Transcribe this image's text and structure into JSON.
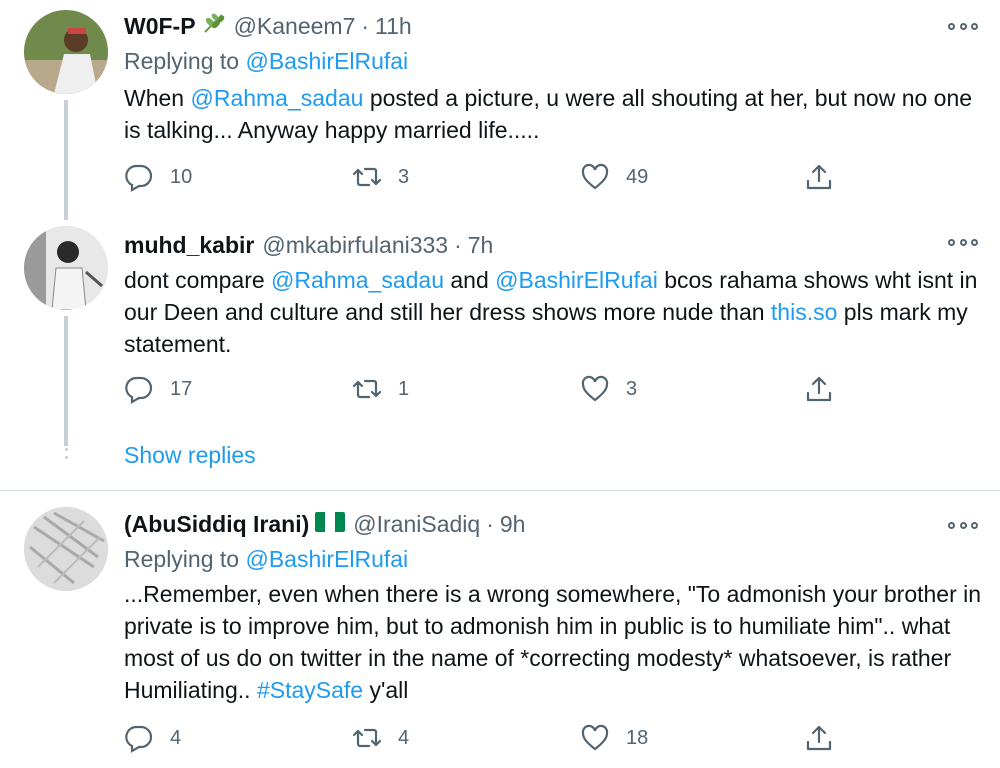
{
  "tweets": [
    {
      "name": "W0F-P",
      "emoji": "herb",
      "handle": "@Kaneem7",
      "time": "11h",
      "replying_prefix": "Replying to",
      "replying_to": "@BashirElRufai",
      "body_parts": [
        {
          "text": "When ",
          "link": false
        },
        {
          "text": "@Rahma_sadau",
          "link": true
        },
        {
          "text": " posted a picture, u were all shouting at her, but now no one is talking... Anyway happy married life.....",
          "link": false
        }
      ],
      "replies": "10",
      "retweets": "3",
      "likes": "49"
    },
    {
      "name": "muhd_kabir",
      "handle": "@mkabirfulani333",
      "time": "7h",
      "body_parts": [
        {
          "text": "dont compare ",
          "link": false
        },
        {
          "text": "@Rahma_sadau",
          "link": true
        },
        {
          "text": " and ",
          "link": false
        },
        {
          "text": "@BashirElRufai",
          "link": true
        },
        {
          "text": " bcos rahama shows wht isnt in our Deen and culture and still her dress shows more nude than ",
          "link": false
        },
        {
          "text": "this.so",
          "link": true
        },
        {
          "text": " pls mark my statement.",
          "link": false
        }
      ],
      "replies": "17",
      "retweets": "1",
      "likes": "3"
    },
    {
      "name": "(AbuSiddiq Irani)",
      "flag": "nigeria-flag",
      "handle": "@IraniSadiq",
      "time": "9h",
      "replying_prefix": "Replying to",
      "replying_to": "@BashirElRufai",
      "body_parts": [
        {
          "text": "...Remember, even when there is a wrong somewhere, \"To admonish your brother in private is to improve him, but to admonish him in public is to humiliate him\".. what most of us do on twitter in the name of *correcting modesty* whatsoever, is rather Humiliating.. ",
          "link": false
        },
        {
          "text": "#StaySafe",
          "link": true
        },
        {
          "text": " y'all",
          "link": false
        }
      ],
      "replies": "4",
      "retweets": "4",
      "likes": "18"
    }
  ],
  "show_replies_label": "Show replies",
  "separator": "·",
  "colors": {
    "link": "#1d9bf0",
    "secondary": "#536471",
    "flag_green": "#008751"
  }
}
